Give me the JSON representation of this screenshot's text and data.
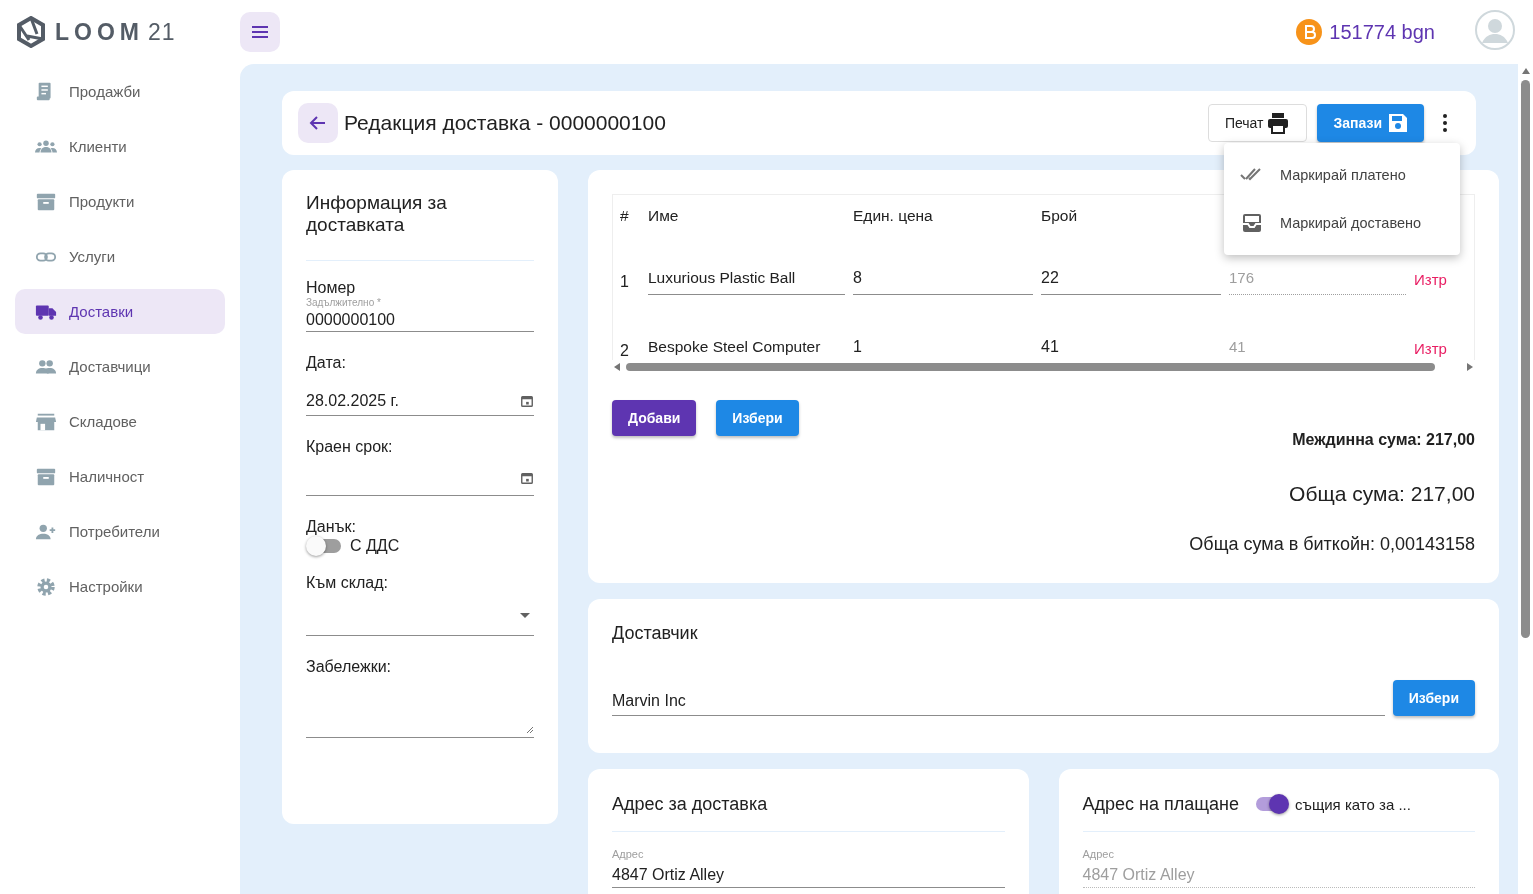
{
  "logo": {
    "text": "LOOM",
    "number": "21"
  },
  "sidebar": {
    "items": [
      {
        "label": "Продажби",
        "selected": false
      },
      {
        "label": "Клиенти",
        "selected": false
      },
      {
        "label": "Продукти",
        "selected": false
      },
      {
        "label": "Услуги",
        "selected": false
      },
      {
        "label": "Доставки",
        "selected": true
      },
      {
        "label": "Доставчици",
        "selected": false
      },
      {
        "label": "Складове",
        "selected": false
      },
      {
        "label": "Наличност",
        "selected": false
      },
      {
        "label": "Потребители",
        "selected": false
      },
      {
        "label": "Настройки",
        "selected": false
      }
    ]
  },
  "balance": "151774 bgn",
  "header": {
    "title": "Редакция доставка - 0000000100",
    "print": "Печат",
    "save": "Запази"
  },
  "menu": {
    "items": [
      "Маркирай платено",
      "Маркирай доставено"
    ]
  },
  "info": {
    "title": "Информация за доставката",
    "number": {
      "label": "Номер",
      "hint": "Задължително *",
      "value": "0000000100"
    },
    "date": {
      "label": "Дата:",
      "value": "28.02.2025 г."
    },
    "due": {
      "label": "Краен срок:"
    },
    "tax": {
      "label": "Данък:",
      "toggle": "С ДДС",
      "on": false
    },
    "warehouse": {
      "label": "Към склад:"
    },
    "notes": {
      "label": "Забележки:"
    }
  },
  "items": {
    "columns": [
      "#",
      "Име",
      "Един. цена",
      "Брой"
    ],
    "rows": [
      {
        "index": "1",
        "name": "Luxurious Plastic Ball",
        "price": "8",
        "qty": "22",
        "total": "176",
        "delete": "Изтр"
      },
      {
        "index": "2",
        "name": "Bespoke Steel Computer",
        "price": "1",
        "qty": "41",
        "total": "41",
        "delete": "Изтр"
      }
    ],
    "add": "Добави",
    "choose": "Избери",
    "subtotal": "Междинна сума: 217,00",
    "total": "Обща сума: 217,00",
    "btc": "Обща сума в биткойн: 0,00143158"
  },
  "supplier": {
    "title": "Доставчик",
    "value": "Marvin Inc",
    "choose": "Избери"
  },
  "shipping": {
    "title": "Адрес за доставка",
    "field_label": "Адрес",
    "value": "4847 Ortiz Alley"
  },
  "billing": {
    "title": "Адрес на плащане",
    "toggle": "същия като за ...",
    "on": true,
    "field_label": "Адрес",
    "value": "4847 Ortiz Alley"
  }
}
